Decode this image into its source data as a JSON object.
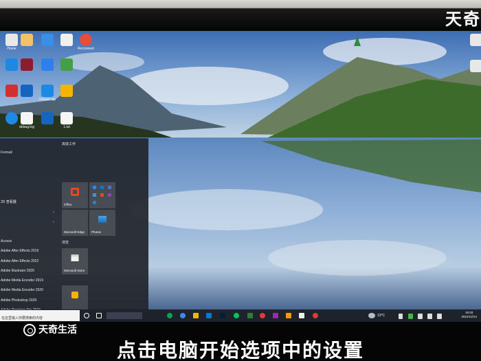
{
  "brand_top": "天奇",
  "watermark": "天奇生活",
  "caption": "点击电脑开始选项中的设置",
  "desktop_icons": [
    {
      "label": "Home",
      "color": "#e8e8e8"
    },
    {
      "label": "",
      "color": "#f2c26b"
    },
    {
      "label": "",
      "color": "#3a8ee6"
    },
    {
      "label": "",
      "color": "#f0f0f0"
    },
    {
      "label": "Reconnect",
      "color": "#e74c3c"
    },
    {
      "label": "",
      "color": "#1e88e5"
    },
    {
      "label": "",
      "color": "#8e1b2f"
    },
    {
      "label": "",
      "color": "#2f80ed"
    },
    {
      "label": "",
      "color": "#43a047"
    },
    {
      "label": "",
      "color": "#d32f2f"
    },
    {
      "label": "",
      "color": "#1565c0"
    },
    {
      "label": "UDown.zip",
      "color": "#1e88e5"
    },
    {
      "label": "",
      "color": "#f4b400"
    },
    {
      "label": "",
      "color": "#1e88e5"
    },
    {
      "label": "debug.log",
      "color": "#f5f5f5"
    },
    {
      "label": "",
      "color": "#1565c0"
    },
    {
      "label": "1.txt",
      "color": "#f5f5f5"
    }
  ],
  "start_menu": {
    "list_items": [
      "",
      "Formail",
      "",
      "",
      "",
      "",
      "3D 查看器",
      "",
      "",
      "",
      "Access",
      "Adobe After Effects 2019",
      "Adobe After Effects 2022",
      "Adobe Illustrator 2020",
      "Adobe Media Encoder 2019",
      "Adobe Media Encoder 2020",
      "Adobe Photoshop 2020",
      "Adobe Premiere Pro 2019"
    ],
    "group1_title": "高效工作",
    "group2_title": "浏览",
    "tiles": {
      "office": "Office",
      "edge": "Microsoft Edge",
      "photos": "Photos",
      "store": "Microsoft Store"
    }
  },
  "taskbar": {
    "search_placeholder": "在这里输入你要搜索的内容",
    "weather": "13°C",
    "time": "16:03",
    "date": "2021/12/14"
  },
  "colors": {
    "taskbar": "#1c2028",
    "start_menu": "#22262c",
    "office_red": "#e64a19"
  }
}
